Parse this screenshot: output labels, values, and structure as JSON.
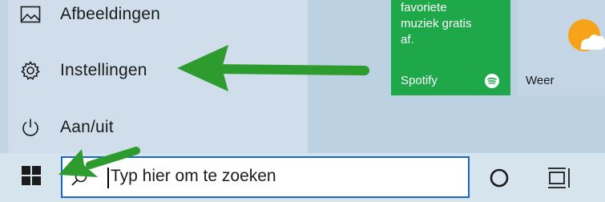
{
  "start_menu": {
    "items": [
      {
        "label": "Afbeeldingen",
        "icon": "pictures-icon"
      },
      {
        "label": "Instellingen",
        "icon": "gear-icon"
      },
      {
        "label": "Aan/uit",
        "icon": "power-icon"
      }
    ]
  },
  "tiles": {
    "spotify": {
      "message_lines": [
        "favoriete",
        "muziek gratis",
        "af."
      ],
      "name": "Spotify",
      "icon": "spotify-icon",
      "color": "#1fa84a"
    },
    "weather": {
      "name": "Weer",
      "icon": "weather-sun-cloud-icon"
    }
  },
  "taskbar": {
    "start_icon": "windows-logo-icon",
    "search": {
      "placeholder": "Typ hier om te zoeken",
      "icon": "search-icon"
    },
    "cortana_icon": "cortana-circle-icon",
    "taskview_icon": "task-view-icon"
  },
  "annotations": {
    "arrow_color": "#2e9b2e"
  }
}
